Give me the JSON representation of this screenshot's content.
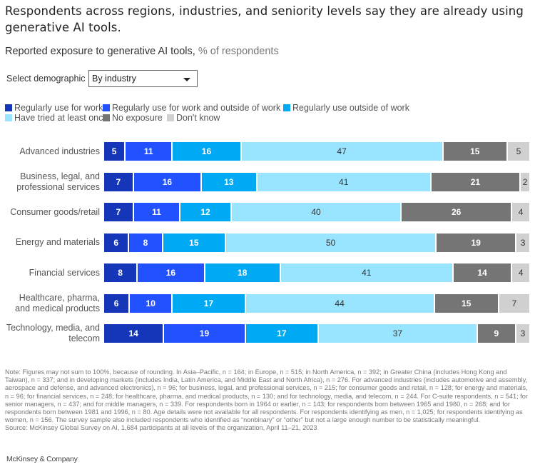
{
  "header": {
    "title": "Respondents across regions, industries, and seniority levels say they are already using generative AI tools.",
    "subtitle_main": "Reported exposure to generative AI tools,",
    "subtitle_unit": " % of respondents"
  },
  "selector": {
    "label": "Select demographic",
    "value": "By industry",
    "icon": "caret-down-icon"
  },
  "colors": {
    "regular_work": "#1536b8",
    "regular_work_and_outside": "#2251ff",
    "regular_outside": "#00a9f4",
    "tried_once": "#99e4ff",
    "no_exposure": "#757575",
    "dont_know": "#d0d0d0"
  },
  "chart_data": {
    "type": "bar",
    "orientation": "horizontal",
    "stacked": true,
    "normalized": true,
    "title": "Reported exposure to generative AI tools",
    "xlabel": "% of respondents",
    "ylabel": "",
    "legend_position": "top-left",
    "categories": [
      "Advanced industries",
      "Business, legal, and professional services",
      "Consumer goods/retail",
      "Energy and materials",
      "Financial services",
      "Healthcare, pharma, and medical products",
      "Technology, media, and telecom"
    ],
    "category_lines": [
      [
        "Advanced industries"
      ],
      [
        "Business, legal, and",
        "professional services"
      ],
      [
        "Consumer goods/retail"
      ],
      [
        "Energy and materials"
      ],
      [
        "Financial services"
      ],
      [
        "Healthcare, pharma,",
        "and medical products"
      ],
      [
        "Technology, media, and",
        "telecom"
      ]
    ],
    "series": [
      {
        "name": "Regularly use for work",
        "color": "#1536b8",
        "label_color": "#ffffff",
        "values": [
          5,
          7,
          7,
          6,
          8,
          6,
          14
        ]
      },
      {
        "name": "Regularly use for work and outside of work",
        "color": "#2251ff",
        "label_color": "#ffffff",
        "values": [
          11,
          16,
          11,
          8,
          16,
          10,
          19
        ]
      },
      {
        "name": "Regularly use outside of work",
        "color": "#00a9f4",
        "label_color": "#ffffff",
        "values": [
          16,
          13,
          12,
          15,
          18,
          17,
          17
        ]
      },
      {
        "name": "Have tried at least once",
        "color": "#99e4ff",
        "label_color": "#333333",
        "values": [
          47,
          41,
          40,
          50,
          41,
          44,
          37
        ]
      },
      {
        "name": "No exposure",
        "color": "#757575",
        "label_color": "#ffffff",
        "values": [
          15,
          21,
          26,
          19,
          14,
          15,
          9
        ]
      },
      {
        "name": "Don't know",
        "color": "#d0d0d0",
        "label_color": "#333333",
        "values": [
          5,
          2,
          4,
          3,
          4,
          7,
          3
        ]
      }
    ]
  },
  "footer": {
    "note": "Note: Figures may not sum to 100%, because of rounding. In Asia–Pacific, n = 164; in Europe, n = 515; in North America, n = 392; in Greater China (includes Hong Kong and Taiwan), n = 337; and in developing markets (includes India, Latin America, and Middle East and North Africa), n = 276. For advanced industries (includes automotive and assembly, aerospace and defense, and advanced electronics), n = 96; for business, legal, and professional services, n = 215; for consumer goods and retail, n = 128; for energy and materials, n = 96; for financial services, n = 248; for healthcare, pharma, and medical products, n = 130; and for technology, media, and telecom, n = 244. For C-suite respondents, n = 541; for senior managers, n = 437; and for middle managers, n = 339. For respondents born in 1964 or earlier, n = 143; for respondents born between 1965 and 1980, n = 268; and for respondents born between 1981 and 1996, n = 80. Age details were not available for all respondents. For respondents identifying as men, n = 1,025; for respondents identifying as women, n = 156. The survey sample also included respondents who identified as “nonbinary” or “other” but not a large enough number to be statistically meaningful.",
    "source": "Source: McKinsey Global Survey on AI, 1,684 participants at all levels of the organization, April 11–21, 2023",
    "brand": "McKinsey & Company"
  }
}
